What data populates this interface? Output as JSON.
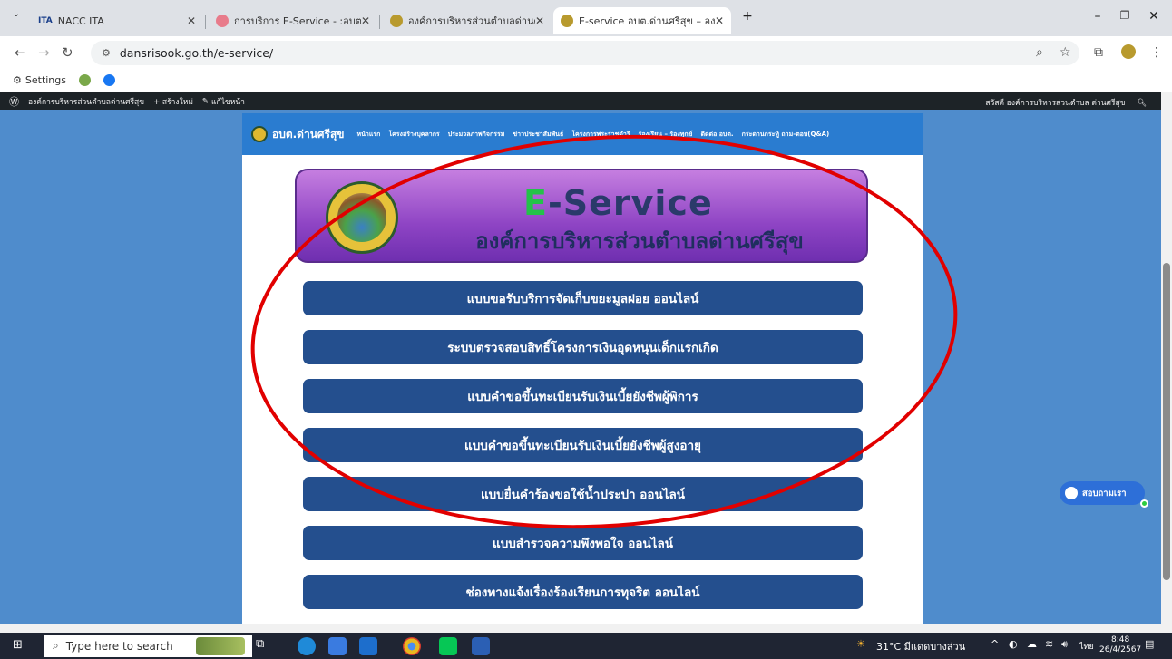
{
  "browser": {
    "tabs": [
      {
        "label": "NACC ITA",
        "favicon": "ITA"
      },
      {
        "label": "การบริการ E-Service - :อบต.โคกกะ..."
      },
      {
        "label": "องค์การบริหารส่วนตำบลด่านศรีสุข - ..."
      },
      {
        "label": "E-service อบต.ด่านศรีสุข – องค์การ..."
      }
    ],
    "url": "dansrisook.go.th/e-service/",
    "bookmarks": {
      "settings": "Settings"
    }
  },
  "wp_admin": {
    "site": "องค์การบริหารส่วนตำบลด่านศรีสุข",
    "new": "+ สร้างใหม่",
    "edit": "แก้ไขหน้า",
    "greeting": "สวัสดี องค์การบริหารส่วนตำบล ด่านศรีสุข"
  },
  "site": {
    "name": "อบต.ด่านศรีสุข",
    "menu": [
      "หน้าแรก",
      "โครงสร้างบุคลากร",
      "ประมวลภาพกิจกรรม",
      "ข่าวประชาสัมพันธ์",
      "โครงการพระราชดำริ",
      "ร้องเรียน – ร้องทุกข์",
      "ติดต่อ อบต.",
      "กระดานกระทู้ ถาม-ตอบ(Q&A)"
    ]
  },
  "banner": {
    "title_e": "E",
    "title_rest": "-Service",
    "subtitle": "องค์การบริหารส่วนตำบลด่านศรีสุข"
  },
  "services": [
    "แบบขอรับบริการจัดเก็บขยะมูลฝอย ออนไลน์",
    "ระบบตรวจสอบสิทธิ์โครงการเงินอุดหนุนเด็กแรกเกิด",
    "แบบคำขอขึ้นทะเบียนรับเงินเบี้ยยังชีพผู้พิการ",
    "แบบคำขอขึ้นทะเบียนรับเงินเบี้ยยังชีพผู้สูงอายุ",
    "แบบยื่นคำร้องขอใช้น้ำประปา ออนไลน์",
    "แบบสำรวจความพึงพอใจ ออนไลน์",
    "ช่องทางแจ้งเรื่องร้องเรียนการทุจริต ออนไลน์"
  ],
  "chat": {
    "label": "สอบถามเรา"
  },
  "taskbar": {
    "search_placeholder": "Type here to search",
    "weather": "31°C มีแดดบางส่วน",
    "lang": "ไทย",
    "time": "8:48",
    "date": "26/4/2567"
  },
  "colors": {
    "service_button": "#244f8e",
    "page_bg": "#4f8ccc",
    "annotation": "#e10000"
  }
}
